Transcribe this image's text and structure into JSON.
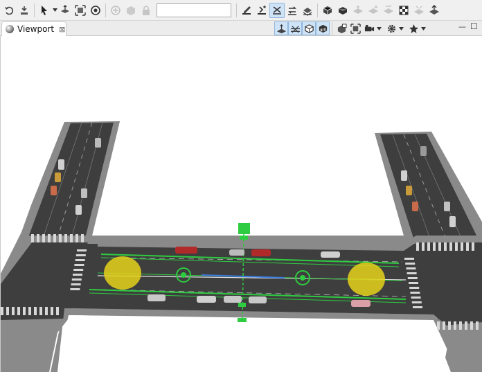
{
  "toolbar": {
    "search_value": "",
    "icons": [
      "undo-icon",
      "redo-icon",
      "select-arrow-icon",
      "move-icon",
      "fit-view-icon",
      "focus-icon",
      "add-object-icon",
      "box-icon",
      "lock-icon",
      "edit-road-icon",
      "add-road-icon",
      "road-junction-icon",
      "road-link-icon",
      "road-layer-icon",
      "cube-icon",
      "cube-solid-icon",
      "lane-icon",
      "lane-split-icon",
      "lane-merge-icon",
      "checker-icon",
      "road-marking-icon",
      "road-object-icon"
    ]
  },
  "tab": {
    "label": "Viewport",
    "close": "⊠"
  },
  "viewport_tools": {
    "icons": [
      "view-mode-1-icon",
      "view-mode-2-icon",
      "view-mode-3-icon",
      "view-mode-4-icon",
      "screenshot-icon",
      "camera-fit-icon",
      "camera-icon",
      "settings-icon",
      "star-icon"
    ]
  },
  "window": {
    "minimize": "—",
    "maximize": "☐"
  },
  "colors": {
    "road": "#3e3e3e",
    "sidewalk": "#8a8a8a",
    "selection": "#2ecc40",
    "lane_highlight": "#3a7de0",
    "signal_zone": "#e6d21a"
  }
}
